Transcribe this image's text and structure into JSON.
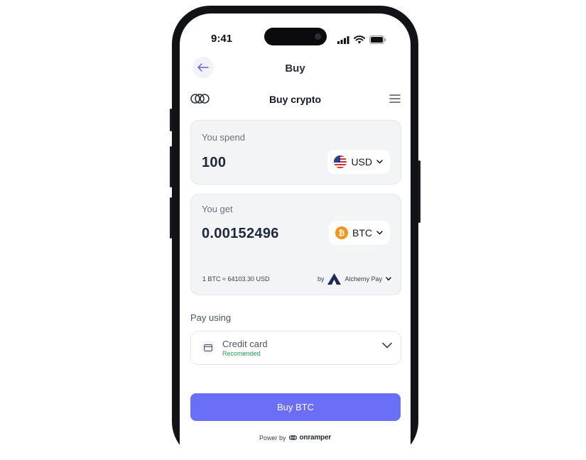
{
  "status_bar": {
    "time": "9:41"
  },
  "header": {
    "title": "Buy"
  },
  "widget": {
    "title": "Buy crypto"
  },
  "spend": {
    "label": "You spend",
    "amount": "100",
    "currency": "USD"
  },
  "get": {
    "label": "You get",
    "amount": "0.00152496",
    "currency": "BTC",
    "rate": "1 BTC ≈ 64103.30 USD",
    "by": "by",
    "provider": "Alchemy Pay"
  },
  "payment": {
    "label": "Pay using",
    "method": "Credit card",
    "note": "Recomended"
  },
  "cta": {
    "label": "Buy BTC"
  },
  "footer": {
    "prefix": "Power by",
    "brand": "onramper"
  },
  "colors": {
    "accent": "#6b6ff7",
    "recommended": "#22a55b",
    "bitcoin": "#f7931a"
  }
}
